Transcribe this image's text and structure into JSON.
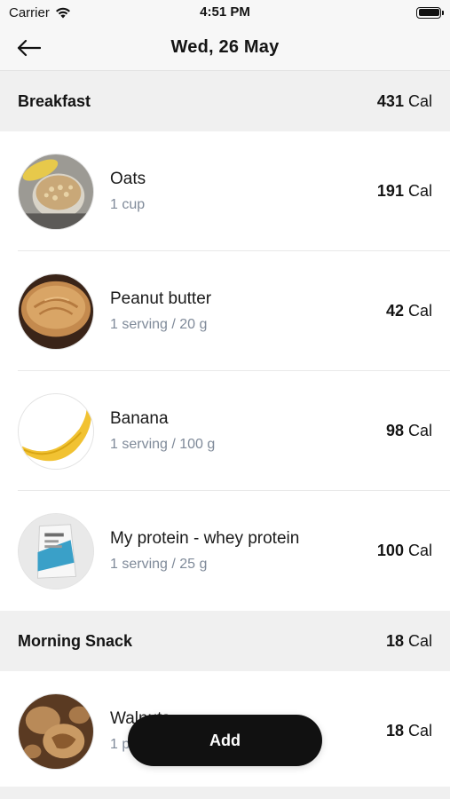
{
  "status_bar": {
    "carrier": "Carrier",
    "time": "4:51 PM"
  },
  "nav": {
    "title": "Wed, 26 May"
  },
  "breakfast": {
    "title": "Breakfast",
    "cal_value": "431",
    "cal_unit": "Cal",
    "items": [
      {
        "name": "Oats",
        "amount": "1 cup",
        "cal_value": "191",
        "cal_unit": "Cal"
      },
      {
        "name": "Peanut butter",
        "amount": "1 serving / 20 g",
        "cal_value": "42",
        "cal_unit": "Cal"
      },
      {
        "name": "Banana",
        "amount": "1 serving / 100 g",
        "cal_value": "98",
        "cal_unit": "Cal"
      },
      {
        "name": "My protein - whey protein",
        "amount": "1 serving / 25 g",
        "cal_value": "100",
        "cal_unit": "Cal"
      }
    ]
  },
  "morning_snack": {
    "title": "Morning Snack",
    "cal_value": "18",
    "cal_unit": "Cal",
    "items": [
      {
        "name": "Walnuts",
        "amount": "1 p",
        "cal_value": "18",
        "cal_unit": "Cal"
      }
    ]
  },
  "add_button": {
    "label": "Add"
  },
  "colors": {
    "accent": "#111111",
    "section_bg": "#f0f0f0",
    "muted_text": "#7f8a99"
  }
}
